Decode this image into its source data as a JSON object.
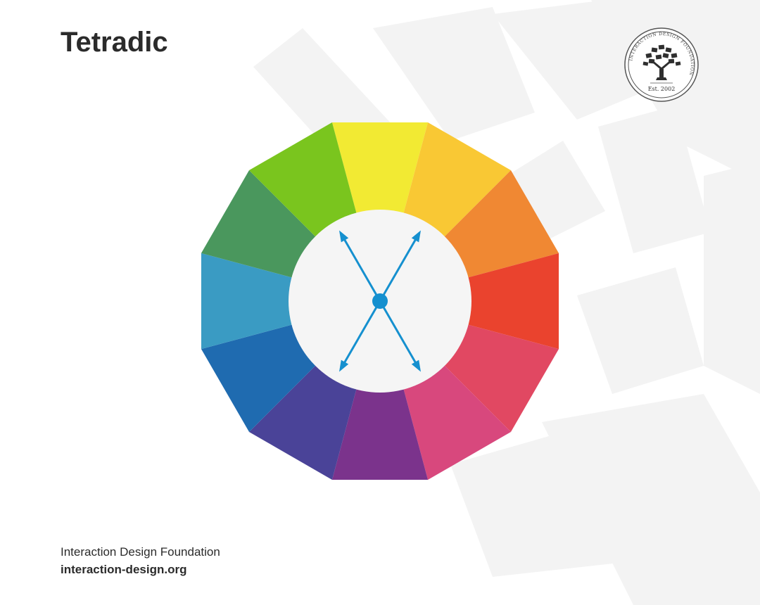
{
  "title": "Tetradic",
  "logo": {
    "ring_text": "INTERACTION DESIGN FOUNDATION",
    "est_text": "Est. 2002"
  },
  "footer": {
    "org_name": "Interaction Design Foundation",
    "url": "interaction-design.org"
  },
  "color_wheel": {
    "segments": [
      {
        "name": "yellow",
        "color": "#F2EA33"
      },
      {
        "name": "yellow-orange",
        "color": "#F9C834"
      },
      {
        "name": "orange",
        "color": "#F08833"
      },
      {
        "name": "red-orange",
        "color": "#EA432E"
      },
      {
        "name": "red",
        "color": "#E14862"
      },
      {
        "name": "red-violet",
        "color": "#D8487D"
      },
      {
        "name": "violet",
        "color": "#7B338C"
      },
      {
        "name": "blue-violet",
        "color": "#4A4398"
      },
      {
        "name": "blue",
        "color": "#1F6BB0"
      },
      {
        "name": "blue-green",
        "color": "#3A9BC3"
      },
      {
        "name": "green",
        "color": "#4A975D"
      },
      {
        "name": "yellow-green",
        "color": "#7AC51E"
      }
    ],
    "center_color": "#F5F5F5",
    "arrow_color": "#1590CF",
    "arrow_targets": [
      "yellow-green",
      "yellow-orange",
      "red-violet",
      "blue-violet"
    ]
  }
}
